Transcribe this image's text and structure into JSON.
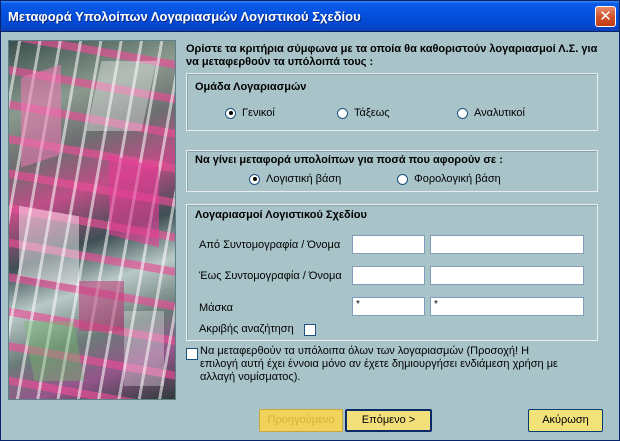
{
  "window": {
    "title": "Μεταφορά Υπολοίπων Λογαριασμών Λογιστικού Σχεδίου",
    "close_glyph": "✕"
  },
  "intro": {
    "text": "Ορίστε τα κριτήρια σύμφωνα με τα οποία θα καθοριστούν λογαριασμοί Λ.Σ. για να μεταφερθούν τα υπόλοιπά τους :"
  },
  "account_group": {
    "title": "Ομάδα Λογαριασμών",
    "options": [
      "Γενικοί",
      "Τάξεως",
      "Αναλυτικοί"
    ],
    "selected": "Γενικοί"
  },
  "transfer_basis": {
    "title": "Να γίνει μεταφορά υπολοίπων για ποσά που αφορούν σε :",
    "options": [
      "Λογιστική βάση",
      "Φορολογική βάση"
    ],
    "selected": "Λογιστική βάση"
  },
  "accounts": {
    "title": "Λογαριασμοί Λογιστικού Σχεδίου",
    "from_label": "Από Συντομογραφία / Όνομα",
    "from_code": "",
    "from_name": "",
    "to_label": "Έως Συντομογραφία / Όνομα",
    "to_code": "",
    "to_name": "",
    "mask_label": "Μάσκα",
    "mask_code": "*",
    "mask_name": "*",
    "exact_search_label": "Ακριβής αναζήτηση",
    "exact_search_checked": false
  },
  "all_accounts": {
    "label": "Να μεταφερθούν τα υπόλοιπα όλων των λογαριασμών (Προσοχή! Η επιλογή αυτή έχει έννοια μόνο αν έχετε δημιουργήσει ενδιάμεση χρήση με αλλαγή νομίσματος).",
    "checked": false
  },
  "buttons": {
    "previous": "Προηγούμενο",
    "next": "Επόμενο >",
    "cancel": "Ακύρωση"
  }
}
